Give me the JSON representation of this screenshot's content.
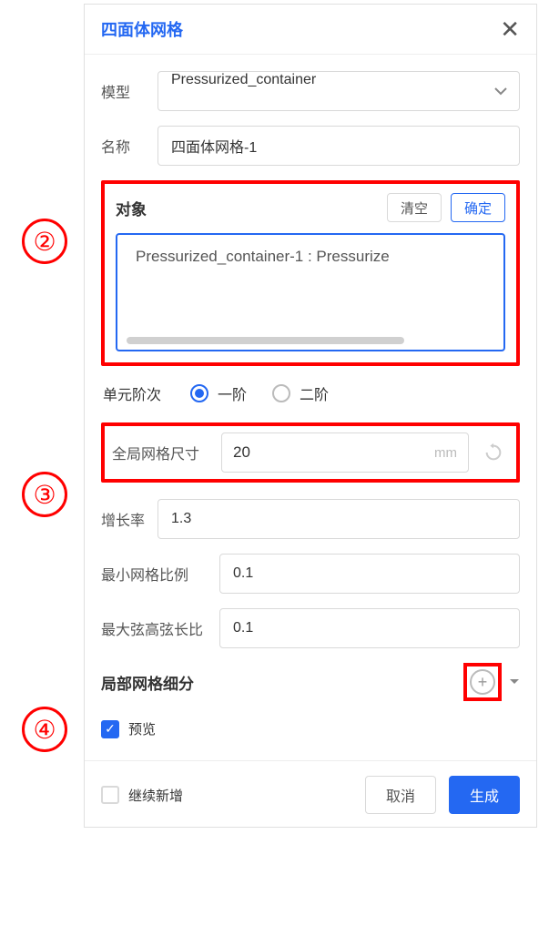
{
  "panel": {
    "title": "四面体网格"
  },
  "labels": {
    "model": "模型",
    "name": "名称",
    "object": "对象",
    "clear": "清空",
    "confirm": "确定",
    "element_order": "单元阶次",
    "first_order": "一阶",
    "second_order": "二阶",
    "global_mesh_size": "全局网格尺寸",
    "unit_mm": "mm",
    "growth_rate": "增长率",
    "min_mesh_ratio": "最小网格比例",
    "max_chord_ratio": "最大弦高弦长比",
    "local_refinement": "局部网格细分",
    "preview": "预览",
    "continue_add": "继续新增",
    "cancel": "取消",
    "generate": "生成"
  },
  "values": {
    "model_selected": "Pressurized_container",
    "name_value": "四面体网格-1",
    "object_item": "Pressurized_container-1 : Pressurize",
    "global_mesh_size": "20",
    "growth_rate": "1.3",
    "min_mesh_ratio": "0.1",
    "max_chord_ratio": "0.1",
    "element_order_selected": "first",
    "preview_checked": true,
    "continue_add_checked": false
  },
  "annotations": {
    "a2": "②",
    "a3": "③",
    "a4": "④"
  }
}
